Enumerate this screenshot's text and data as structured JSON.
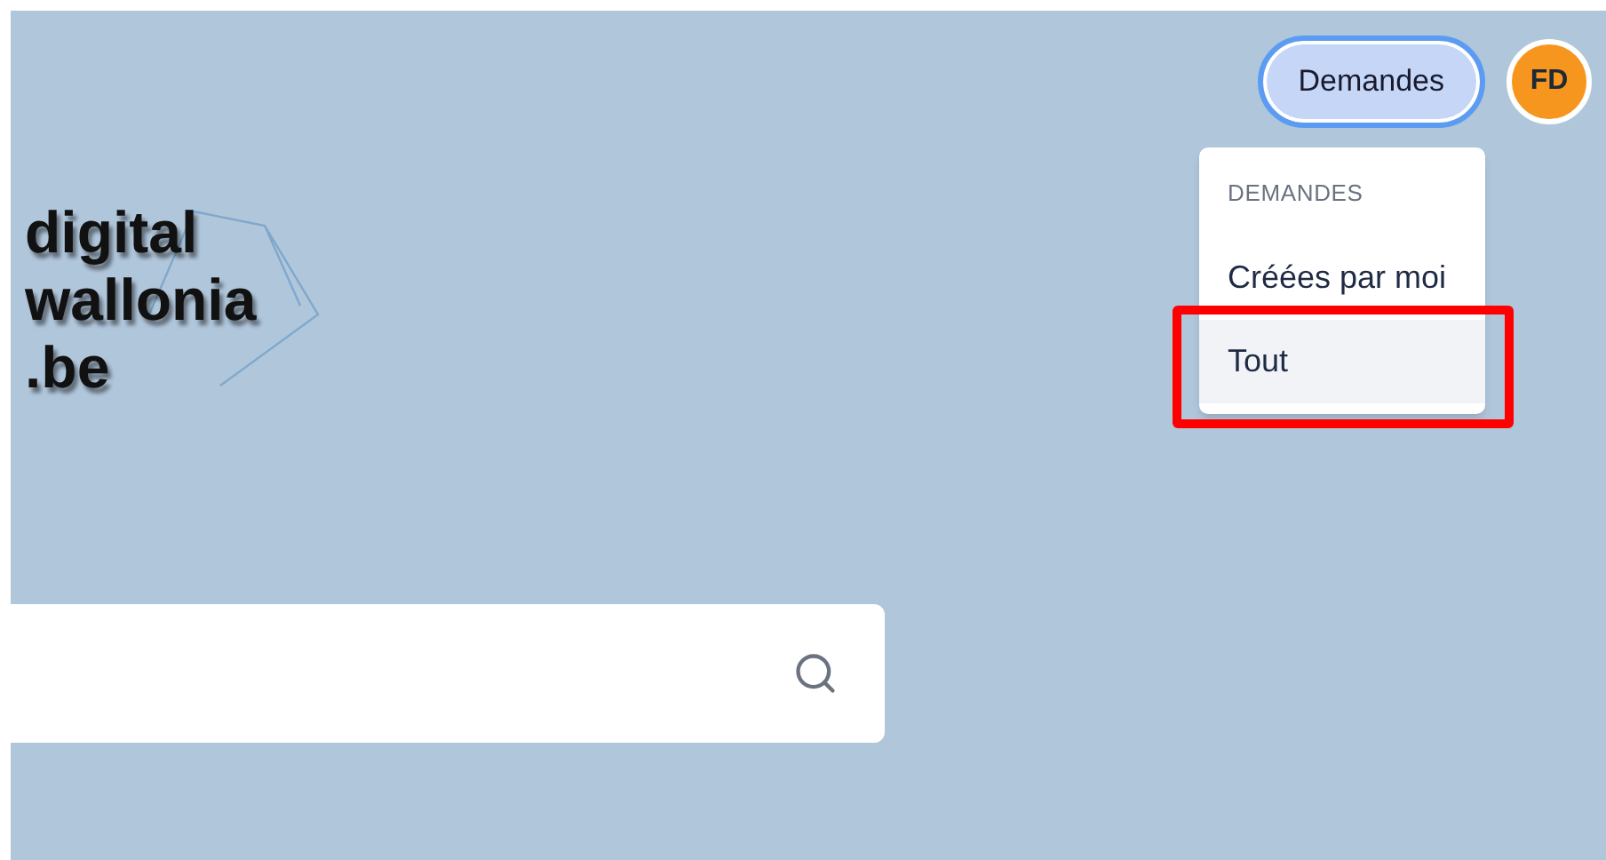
{
  "header": {
    "requests_button": {
      "label": "Demandes",
      "active": true
    },
    "avatar": {
      "initials": "FD",
      "color": "#f7961e"
    }
  },
  "dropdown": {
    "heading": "DEMANDES",
    "items": [
      {
        "label": "Créées par moi",
        "selected": false,
        "highlighted": false
      },
      {
        "label": "Tout",
        "selected": true,
        "highlighted": true
      }
    ]
  },
  "logo": {
    "lines": [
      "digital",
      "wallonia",
      ".be"
    ]
  }
}
